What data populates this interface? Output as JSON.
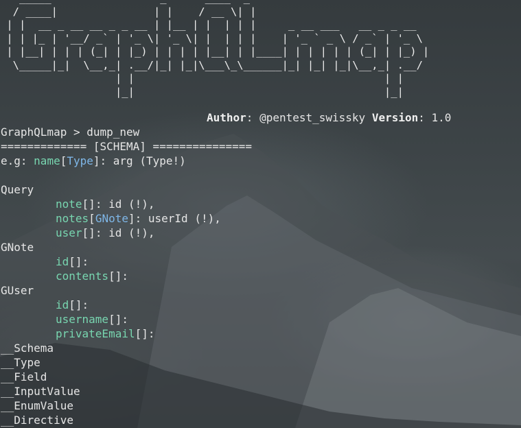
{
  "banner": {
    "ascii_art": "   _____                 _      ____  _\n  / ____|               | |    / __ \\| |\n | |  __ _ __ __ _ _ __ | |__ | |  | | |     _ __ ___   __ _ _ __\n | | |_ | '__/ _` | '_ \\| '_ \\| |  | | |    | '_ ` _ \\ / _` | '_ \\\n | |__| | | | (_| | |_) | | | | |__| | |____| | | | | | (_| | |_) |\n  \\_____|_|  \\__,_| .__/|_| |_|\\___\\_\\______|_| |_| |_|\\__,_| .__/\n                  | |                                       | |\n                  |_|                                       |_|",
    "author_label": "Author",
    "author_value": ": @pentest_swissky ",
    "version_label": "Version",
    "version_value": ": 1.0"
  },
  "prompt": {
    "text": "GraphQLmap > dump_new"
  },
  "schema": {
    "header": "============= [SCHEMA] ===============",
    "example_prefix": "e.g: ",
    "example_name": "name",
    "example_bracket_open": "[",
    "example_type": "Type",
    "example_bracket_close": "]",
    "example_rest": ": arg (Type!)",
    "types": [
      {
        "name": "Query",
        "fields": [
          {
            "name": "note",
            "type": "",
            "args": ": id (!),"
          },
          {
            "name": "notes",
            "type": "GNote",
            "args": ": userId (!),"
          },
          {
            "name": "user",
            "type": "",
            "args": ": id (!),"
          }
        ]
      },
      {
        "name": "GNote",
        "fields": [
          {
            "name": "id",
            "type": "",
            "args": ":"
          },
          {
            "name": "contents",
            "type": "",
            "args": ":"
          }
        ]
      },
      {
        "name": "GUser",
        "fields": [
          {
            "name": "id",
            "type": "",
            "args": ":"
          },
          {
            "name": "username",
            "type": "",
            "args": ":"
          },
          {
            "name": "privateEmail",
            "type": "",
            "args": ":"
          }
        ]
      }
    ],
    "meta_types": [
      "__Schema",
      "__Type",
      "__Field",
      "__InputValue",
      "__EnumValue",
      "__Directive"
    ]
  },
  "colors": {
    "field_name": "#78d6b0",
    "type_ref": "#7fb7e8",
    "text": "#e6e6e6",
    "background": "#3d4447"
  }
}
